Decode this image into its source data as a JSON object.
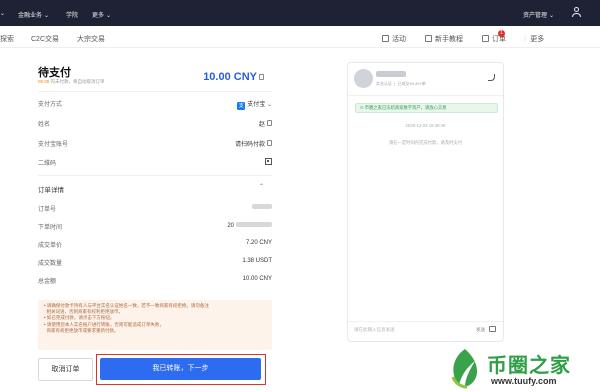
{
  "topnav": {
    "items": [
      "金融业务",
      "学院",
      "更多"
    ],
    "right_label": "资产管理"
  },
  "subnav": {
    "left_items": [
      "探索",
      "C2C交易",
      "大宗交易"
    ],
    "right_items": [
      "活动",
      "新手教程",
      "订单",
      "更多"
    ],
    "order_badge": "1"
  },
  "payment": {
    "title": "待支付",
    "countdown_time": "09:35",
    "countdown_text": "内未付款，将自动取消订单",
    "amount": "10.00 CNY",
    "rows": [
      {
        "label": "支付方式",
        "value": "支付宝"
      },
      {
        "label": "姓名",
        "value": "赵"
      },
      {
        "label": "支付宝账号",
        "value": "请扫码付款"
      },
      {
        "label": "二维码",
        "value": ""
      }
    ]
  },
  "details": {
    "title": "订单详情",
    "rows": [
      {
        "label": "订单号",
        "value": ""
      },
      {
        "label": "下单时间",
        "value": "20"
      },
      {
        "label": "成交单价",
        "value": "7.20 CNY"
      },
      {
        "label": "成交数量",
        "value": "1.38 USDT"
      },
      {
        "label": "总金额",
        "value": "10.00 CNY"
      }
    ]
  },
  "notice": [
    "请确保付款卡持有人与平台实名认证姓名一致，若不一致商家有权拒绝。请勿备注",
    "相关词语，否则商家有权利拒绝放币。",
    "如已完成付款，请点击下方按钮。",
    "请使用您本人实名账户进行转账，否则可能造成订单失败，",
    "商家有权拒绝放币或要求重新付款。"
  ],
  "buttons": {
    "cancel": "取消订单",
    "confirm": "我已转账，下一步"
  },
  "chat": {
    "verified": "实名认证",
    "trades": "已成交69,497单",
    "system_message": "币圈之家已冻结商家数字资产，请放心交易",
    "timestamp": "2020-12-03 16:38:49",
    "note": "请在一定时间内完成付款，请及时支付",
    "input_placeholder": "请在此输入信息发送",
    "send": "发送"
  },
  "watermark": {
    "text": "币圈之家",
    "url": "www.tuufy.com"
  },
  "colors": {
    "brand_blue": "#2d6bf0",
    "highlight_red": "#d8332f",
    "top_bar": "#1f2235"
  }
}
